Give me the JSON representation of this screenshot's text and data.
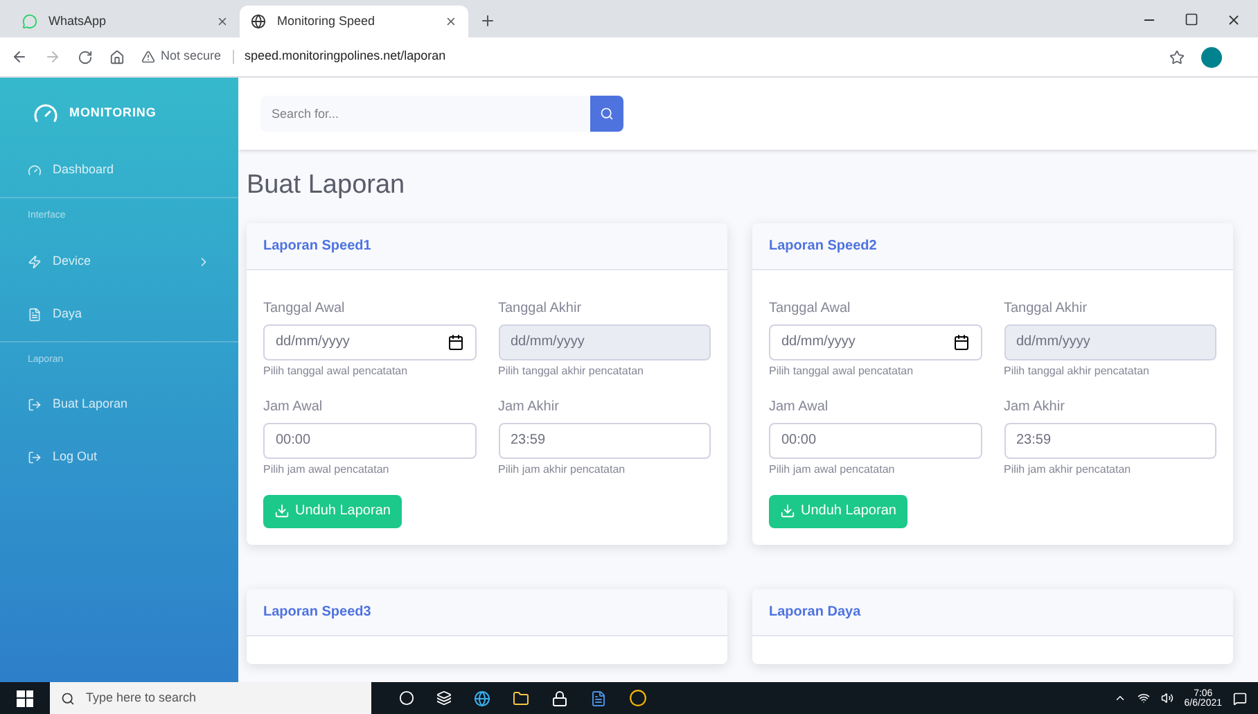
{
  "browser": {
    "tabs": [
      {
        "title": "WhatsApp",
        "selected": false
      },
      {
        "title": "Monitoring Speed",
        "selected": true
      }
    ],
    "security": "Not secure",
    "url": "speed.monitoringpolines.net/laporan"
  },
  "sidebar": {
    "brand": "MONITORING",
    "items": [
      {
        "kind": "item",
        "label": "Dashboard",
        "expandable": false
      },
      {
        "kind": "heading",
        "label": "Interface"
      },
      {
        "kind": "item",
        "label": "Device",
        "expandable": true
      },
      {
        "kind": "item",
        "label": "Daya",
        "expandable": false
      },
      {
        "kind": "heading",
        "label": "Laporan"
      },
      {
        "kind": "item",
        "label": "Buat Laporan",
        "expandable": false
      },
      {
        "kind": "item",
        "label": "Log Out",
        "expandable": false
      }
    ]
  },
  "topbar": {
    "search": {
      "placeholder": "Search for..."
    }
  },
  "page_title": "Buat Laporan",
  "cards": [
    {
      "title": "Laporan Speed1",
      "fields": [
        {
          "kind": "date",
          "label": "Tanggal Awal",
          "value": "dd/mm/yyyy",
          "hint": "Pilih tanggal awal pencatatan",
          "disabled": false
        },
        {
          "kind": "date",
          "label": "Tanggal Akhir",
          "value": "dd/mm/yyyy",
          "hint": "Pilih tanggal akhir pencatatan",
          "disabled": true
        },
        {
          "kind": "time",
          "label": "Jam Awal",
          "value": "00:00",
          "hint": "Pilih jam awal pencatatan",
          "disabled": false
        },
        {
          "kind": "time",
          "label": "Jam Akhir",
          "value": "23:59",
          "hint": "Pilih jam akhir pencatatan",
          "disabled": false
        }
      ],
      "button": "Unduh Laporan"
    },
    {
      "title": "Laporan Speed2",
      "fields": [
        {
          "kind": "date",
          "label": "Tanggal Awal",
          "value": "dd/mm/yyyy",
          "hint": "Pilih tanggal awal pencatatan",
          "disabled": false
        },
        {
          "kind": "date",
          "label": "Tanggal Akhir",
          "value": "dd/mm/yyyy",
          "hint": "Pilih tanggal akhir pencatatan",
          "disabled": true
        },
        {
          "kind": "time",
          "label": "Jam Awal",
          "value": "00:00",
          "hint": "Pilih jam awal pencatatan",
          "disabled": false
        },
        {
          "kind": "time",
          "label": "Jam Akhir",
          "value": "23:59",
          "hint": "Pilih jam akhir pencatatan",
          "disabled": false
        }
      ],
      "button": "Unduh Laporan"
    },
    {
      "title": "Laporan Speed3"
    },
    {
      "title": "Laporan Daya"
    }
  ],
  "taskbar": {
    "search": {
      "placeholder": "Type here to search"
    },
    "time": "7:06",
    "date": "6/6/2021"
  }
}
